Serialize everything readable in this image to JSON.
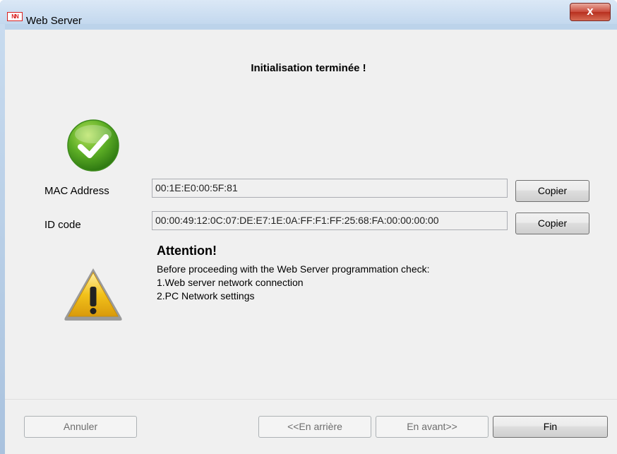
{
  "window": {
    "title": "Web Server",
    "app_icon_text": "NN",
    "close_symbol": "x"
  },
  "heading": "Initialisation terminée !",
  "fields": {
    "mac": {
      "label": "MAC Address",
      "value": "00:1E:E0:00:5F:81",
      "copy_label": "Copier"
    },
    "id": {
      "label": "ID code",
      "value": "00:00:49:12:0C:07:DE:E7:1E:0A:FF:F1:FF:25:68:FA:00:00:00:00",
      "copy_label": "Copier"
    }
  },
  "attention": {
    "title": "Attention!",
    "lines": [
      "Before proceeding with the Web Server programmation check:",
      "1.Web server network connection",
      "2.PC Network settings"
    ]
  },
  "footer": {
    "cancel": "Annuler",
    "back": "<<En arrière",
    "next": "En avant>>",
    "finish": "Fin"
  },
  "icons": {
    "success": "check-circle-icon",
    "warning": "warning-triangle-icon"
  },
  "colors": {
    "titlebar": "#c3d8ee",
    "close_button": "#c9493a",
    "success_green": "#5cad25",
    "warning_yellow": "#f2c21b"
  }
}
